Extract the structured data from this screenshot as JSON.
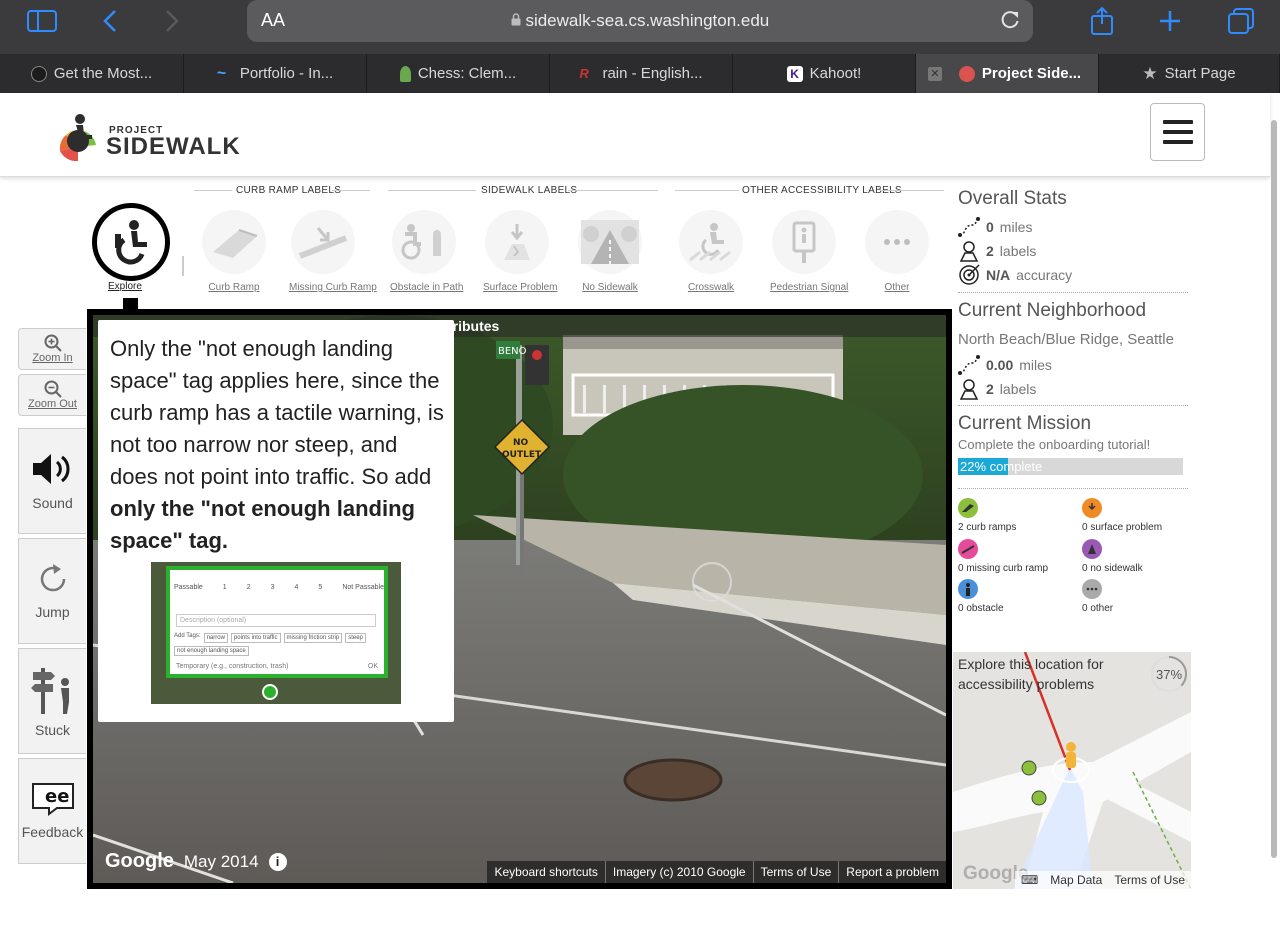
{
  "browser": {
    "reader_label": "AA",
    "url": "sidewalk-sea.cs.washington.edu",
    "tabs": [
      {
        "title": "Get the Most...",
        "favicon_color": "#1c1c1c"
      },
      {
        "title": "Portfolio - In...",
        "favicon_color": "#4da3ff"
      },
      {
        "title": "Chess: Clem...",
        "favicon_color": "#6aa84f"
      },
      {
        "title": "rain - English...",
        "favicon_color": "#cc3333"
      },
      {
        "title": "Kahoot!",
        "favicon_color": "#46178f"
      },
      {
        "title": "Project Side...",
        "favicon_color": "#d9534f",
        "active": true
      },
      {
        "title": "Start Page",
        "favicon_color": "#bbbbbb"
      }
    ]
  },
  "header": {
    "logo_top": "PROJECT",
    "logo_bottom": "SIDEWALK"
  },
  "label_groups": [
    {
      "title": "CURB RAMP LABELS"
    },
    {
      "title": "SIDEWALK LABELS"
    },
    {
      "title": "OTHER ACCESSIBILITY LABELS"
    }
  ],
  "tools": {
    "explore": "Explore",
    "items": [
      {
        "label": "Curb Ramp"
      },
      {
        "label": "Missing Curb Ramp"
      },
      {
        "label": "Obstacle in Path"
      },
      {
        "label": "Surface Problem"
      },
      {
        "label": "No Sidewalk"
      },
      {
        "label": "Crosswalk"
      },
      {
        "label": "Pedestrian Signal"
      },
      {
        "label": "Other"
      }
    ]
  },
  "controls": {
    "zoom_in": "Zoom In",
    "zoom_out": "Zoom Out",
    "sound": "Sound",
    "jump": "Jump",
    "stuck": "Stuck",
    "feedback": "Feedback"
  },
  "panorama": {
    "title_fragment": "tributes",
    "google": "Google",
    "date": "May 2014",
    "links": [
      "Keyboard shortcuts",
      "Imagery (c) 2010 Google",
      "Terms of Use",
      "Report a problem"
    ],
    "sign_text_1": "NO",
    "sign_text_2": "OUTLET",
    "street_sign": "BENO"
  },
  "tutorial": {
    "text_plain": "Only the \"not enough landing space\" tag applies here, since the curb ramp has a tactile warning, is not too narrow nor steep, and does not point into traffic. So add ",
    "text_bold": "only the \"not enough landing space\" tag.",
    "example": {
      "passable": "Passable",
      "not_passable": "Not Passable",
      "scale": [
        "1",
        "2",
        "3",
        "4",
        "5"
      ],
      "description_placeholder": "Description (optional)",
      "add_tags": "Add Tags:",
      "tags": [
        "narrow",
        "points into traffic",
        "missing friction strip",
        "steep",
        "not enough landing space"
      ],
      "temporary": "Temporary (e.g., construction, trash)",
      "ok": "OK"
    }
  },
  "stats": {
    "overall_title": "Overall Stats",
    "overall_miles_value": "0",
    "overall_miles_unit": "miles",
    "overall_labels_value": "2",
    "overall_labels_unit": "labels",
    "accuracy_value": "N/A",
    "accuracy_unit": "accuracy",
    "neighborhood_title": "Current Neighborhood",
    "neighborhood_name": "North Beach/Blue Ridge, Seattle",
    "nbhd_miles_value": "0.00",
    "nbhd_miles_unit": "miles",
    "nbhd_labels_value": "2",
    "nbhd_labels_unit": "labels",
    "mission_title": "Current Mission",
    "mission_text": "Complete the onboarding tutorial!",
    "mission_progress_label": "22% complete",
    "mission_progress": 0.22
  },
  "legend": [
    {
      "label": "2 curb ramps",
      "color": "#8bbf3c"
    },
    {
      "label": "0 surface problem",
      "color": "#f08a24"
    },
    {
      "label": "0 missing curb ramp",
      "color": "#e44c9a"
    },
    {
      "label": "0 no sidewalk",
      "color": "#9b59b6"
    },
    {
      "label": "0 obstacle",
      "color": "#4a90d9"
    },
    {
      "label": "0 other",
      "color": "#aaaaaa"
    }
  ],
  "minimap": {
    "message": "Explore this location for accessibility problems",
    "percent": "37%",
    "percent_value": 0.37,
    "google": "Google",
    "links": [
      "Map Data",
      "Terms of Use"
    ]
  }
}
